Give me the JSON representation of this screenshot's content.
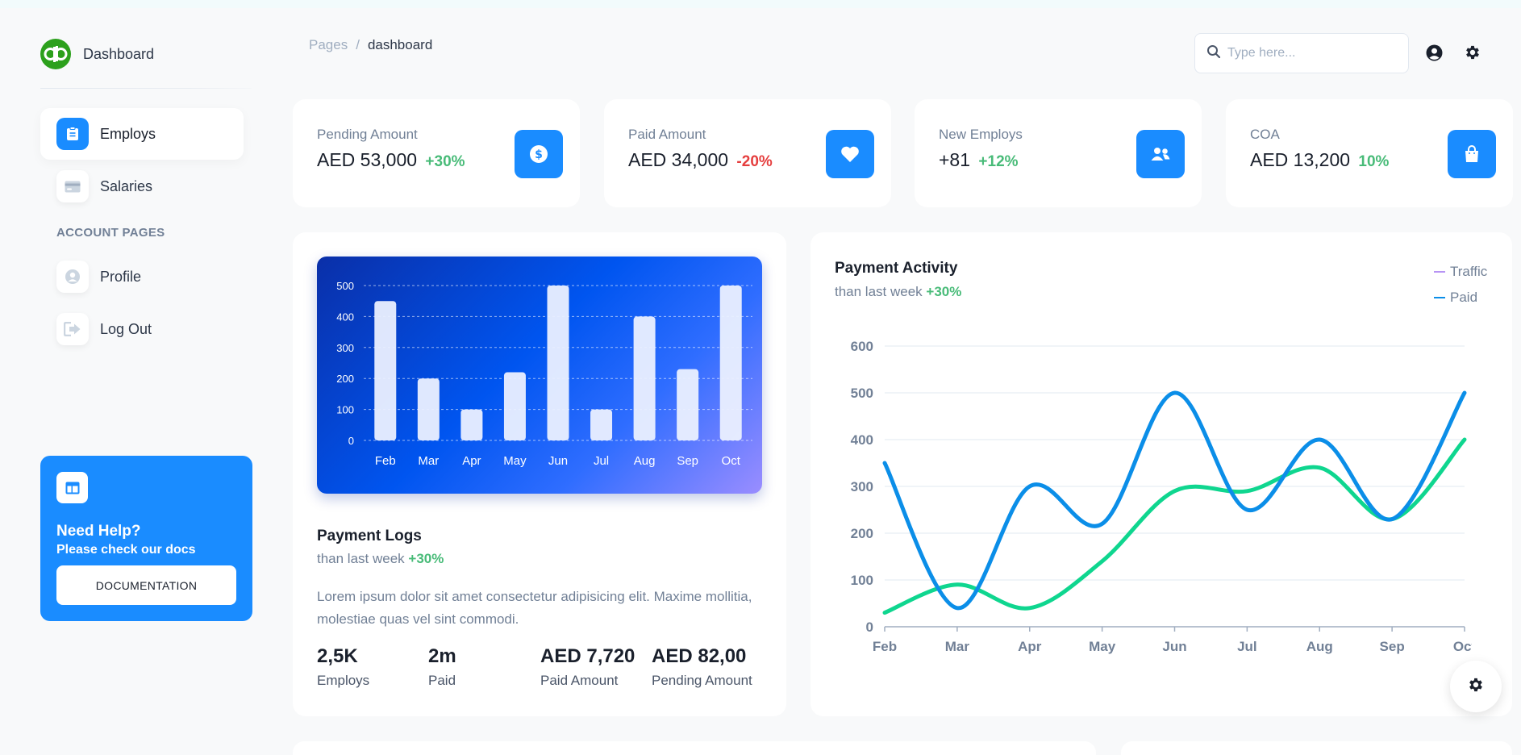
{
  "brand": {
    "name": "Dashboard"
  },
  "sidebar": {
    "items": [
      {
        "label": "Employs",
        "icon": "clipboard-icon",
        "active": true
      },
      {
        "label": "Salaries",
        "icon": "credit-card-icon",
        "active": false
      }
    ],
    "section_title": "ACCOUNT PAGES",
    "account_items": [
      {
        "label": "Profile",
        "icon": "user-icon"
      },
      {
        "label": "Log Out",
        "icon": "logout-icon"
      }
    ],
    "help": {
      "title": "Need Help?",
      "subtitle": "Please check our docs",
      "button": "DOCUMENTATION"
    }
  },
  "header": {
    "breadcrumb": {
      "parent": "Pages",
      "separator": "/",
      "current": "dashboard"
    },
    "search_placeholder": "Type here..."
  },
  "stats": [
    {
      "label": "Pending Amount",
      "value": "AED 53,000",
      "delta": "+30%",
      "trend": "positive",
      "icon": "dollar-icon"
    },
    {
      "label": "Paid Amount",
      "value": "AED 34,000",
      "delta": "-20%",
      "trend": "negative",
      "icon": "heart-icon"
    },
    {
      "label": "New Employs",
      "value": "+81",
      "delta": "+12%",
      "trend": "positive",
      "icon": "users-icon"
    },
    {
      "label": "COA",
      "value": "AED 13,200",
      "delta": "10%",
      "trend": "positive",
      "icon": "bag-icon"
    }
  ],
  "payment_logs": {
    "title": "Payment Logs",
    "subtitle_prefix": "than last week",
    "subtitle_delta": "+30%",
    "description": "Lorem ipsum dolor sit amet consectetur adipisicing elit. Maxime mollitia, molestiae quas vel sint commodi.",
    "metrics": [
      {
        "value": "2,5K",
        "label": "Employs"
      },
      {
        "value": "2m",
        "label": "Paid"
      },
      {
        "value": "AED 7,720",
        "label": "Paid Amount"
      },
      {
        "value": "AED 82,00",
        "label": "Pending Amount"
      }
    ]
  },
  "payment_activity": {
    "title": "Payment Activity",
    "subtitle_prefix": "than last week",
    "subtitle_delta": "+30%"
  },
  "colors": {
    "accent": "#1a8cff",
    "positive": "#48bb78",
    "negative": "#e53e3e",
    "traffic": "#b794f4",
    "paid": "#0b8ee8",
    "green_line": "#0fd68f"
  },
  "chart_data": [
    {
      "type": "bar",
      "categories": [
        "Feb",
        "Mar",
        "Apr",
        "May",
        "Jun",
        "Jul",
        "Aug",
        "Sep",
        "Oct"
      ],
      "values": [
        450,
        200,
        100,
        220,
        500,
        100,
        400,
        230,
        500
      ],
      "ylim": [
        0,
        500
      ],
      "yticks": [
        0,
        100,
        200,
        300,
        400,
        500
      ],
      "grid": true
    },
    {
      "type": "line",
      "categories": [
        "Feb",
        "Mar",
        "Apr",
        "May",
        "Jun",
        "Jul",
        "Aug",
        "Sep",
        "Oct"
      ],
      "series": [
        {
          "name": "Traffic",
          "values": [
            30,
            90,
            40,
            140,
            290,
            290,
            340,
            230,
            400
          ]
        },
        {
          "name": "Paid",
          "values": [
            350,
            40,
            300,
            220,
            500,
            250,
            400,
            230,
            500
          ]
        }
      ],
      "ylim": [
        0,
        600
      ],
      "yticks": [
        0,
        100,
        200,
        300,
        400,
        500,
        600
      ],
      "legend": "top-right",
      "grid": true
    }
  ]
}
